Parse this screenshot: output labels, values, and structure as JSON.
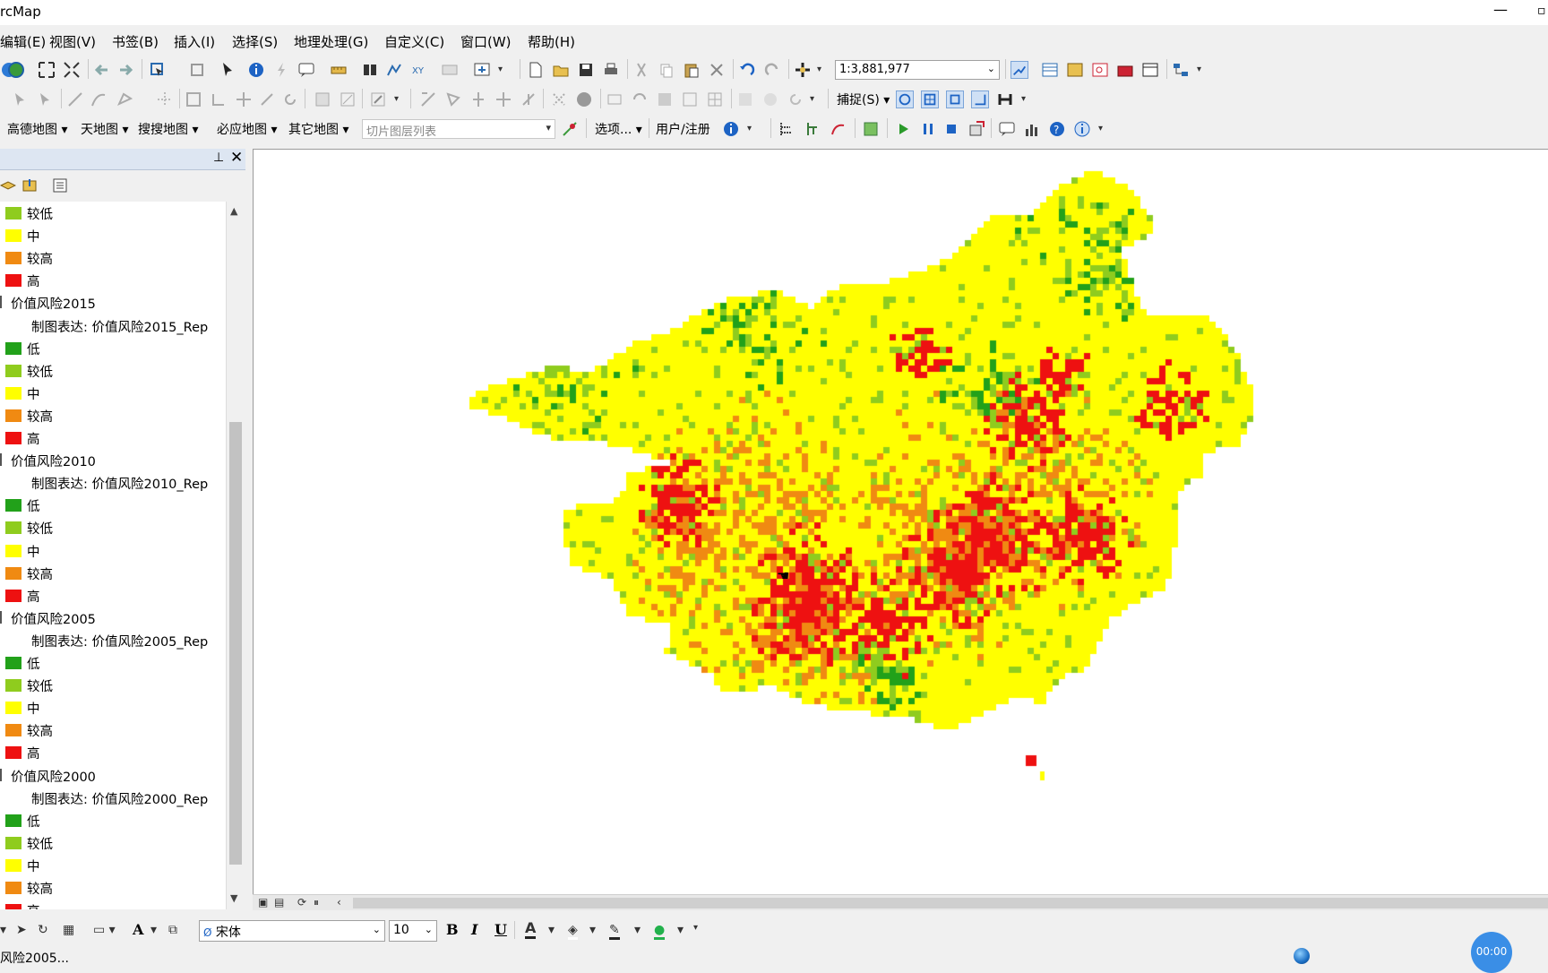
{
  "window": {
    "title": "rcMap"
  },
  "menu": [
    "编辑(E)",
    "视图(V)",
    "书签(B)",
    "插入(I)",
    "选择(S)",
    "地理处理(G)",
    "自定义(C)",
    "窗口(W)",
    "帮助(H)"
  ],
  "toolbar": {
    "scale_value": "1:3,881,977",
    "snap_label": "捕捉(S)",
    "map_sources": [
      "高德地图",
      "天地图",
      "搜搜地图",
      "必应地图",
      "其它地图"
    ],
    "tile_list_placeholder": "切片图层列表",
    "options_label": "选项...",
    "user_register_label": "用户/注册"
  },
  "toc": {
    "layers": [
      {
        "type": "class",
        "label": "较低",
        "color": "#8fcc1e"
      },
      {
        "type": "class",
        "label": "中",
        "color": "#ffff00"
      },
      {
        "type": "class",
        "label": "较高",
        "color": "#f08a12"
      },
      {
        "type": "class",
        "label": "高",
        "color": "#ee1111"
      },
      {
        "type": "layer",
        "label": "价值风险2015"
      },
      {
        "type": "rep",
        "label": "制图表达: 价值风险2015_Rep"
      },
      {
        "type": "class",
        "label": "低",
        "color": "#22a11a"
      },
      {
        "type": "class",
        "label": "较低",
        "color": "#8fcc1e"
      },
      {
        "type": "class",
        "label": "中",
        "color": "#ffff00"
      },
      {
        "type": "class",
        "label": "较高",
        "color": "#f08a12"
      },
      {
        "type": "class",
        "label": "高",
        "color": "#ee1111"
      },
      {
        "type": "layer",
        "label": "价值风险2010"
      },
      {
        "type": "rep",
        "label": "制图表达: 价值风险2010_Rep"
      },
      {
        "type": "class",
        "label": "低",
        "color": "#22a11a"
      },
      {
        "type": "class",
        "label": "较低",
        "color": "#8fcc1e"
      },
      {
        "type": "class",
        "label": "中",
        "color": "#ffff00"
      },
      {
        "type": "class",
        "label": "较高",
        "color": "#f08a12"
      },
      {
        "type": "class",
        "label": "高",
        "color": "#ee1111"
      },
      {
        "type": "layer",
        "label": "价值风险2005"
      },
      {
        "type": "rep",
        "label": "制图表达: 价值风险2005_Rep"
      },
      {
        "type": "class",
        "label": "低",
        "color": "#22a11a"
      },
      {
        "type": "class",
        "label": "较低",
        "color": "#8fcc1e"
      },
      {
        "type": "class",
        "label": "中",
        "color": "#ffff00"
      },
      {
        "type": "class",
        "label": "较高",
        "color": "#f08a12"
      },
      {
        "type": "class",
        "label": "高",
        "color": "#ee1111"
      },
      {
        "type": "layer",
        "label": "价值风险2000"
      },
      {
        "type": "rep",
        "label": "制图表达: 价值风险2000_Rep"
      },
      {
        "type": "class",
        "label": "低",
        "color": "#22a11a"
      },
      {
        "type": "class",
        "label": "较低",
        "color": "#8fcc1e"
      },
      {
        "type": "class",
        "label": "中",
        "color": "#ffff00"
      },
      {
        "type": "class",
        "label": "较高",
        "color": "#f08a12"
      },
      {
        "type": "class",
        "label": "高",
        "color": "#ee1111"
      }
    ]
  },
  "drawing": {
    "font_name": "宋体",
    "font_size": "10",
    "bold": "B",
    "italic": "I",
    "underline": "U",
    "text_tool": "A"
  },
  "status": {
    "text": "风险2005...",
    "timer": "00:00"
  },
  "colors": {
    "low": "#22a11a",
    "lower": "#8fcc1e",
    "mid": "#ffff00",
    "higher": "#f08a12",
    "high": "#ee1111"
  }
}
